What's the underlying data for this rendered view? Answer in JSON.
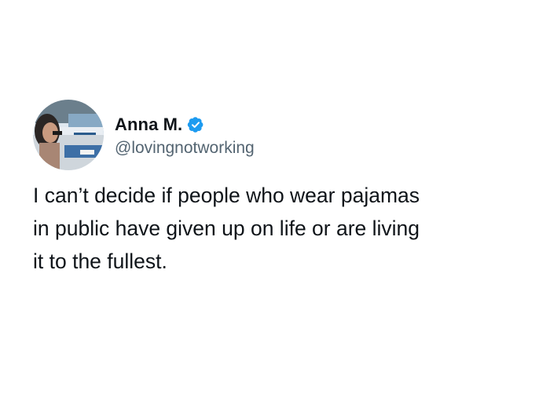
{
  "tweet": {
    "author": {
      "display_name": "Anna M.",
      "handle": "@lovingnotworking",
      "verified": true,
      "verified_color": "#1d9bf0"
    },
    "text_lines": [
      "I can’t decide if people who wear pajamas",
      "in public have given up on life or are living",
      "it to the fullest."
    ]
  }
}
